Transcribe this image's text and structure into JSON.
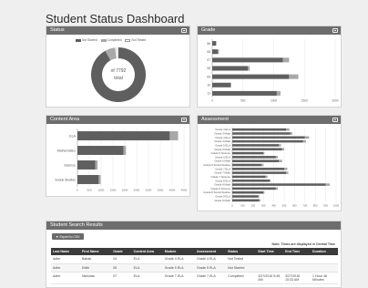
{
  "page": {
    "title": "Student Status Dashboard"
  },
  "panels": {
    "status": "Status",
    "grade": "Grade",
    "content": "Content Area",
    "assessment": "Assessment",
    "results": "Student Search Results"
  },
  "status": {
    "legend": [
      "Not Started",
      "Completed",
      "Not Tested"
    ],
    "center_line1": "of 7792",
    "center_line2": "total"
  },
  "colors": {
    "dark": "#5f5f5f",
    "light": "#a8a8a8",
    "white": "#ffffff"
  },
  "chart_data": [
    {
      "type": "pie",
      "title": "Status",
      "categories": [
        "Not Started",
        "Completed",
        "Not Tested"
      ],
      "values": [
        92,
        6,
        2
      ]
    },
    {
      "type": "bar",
      "title": "Grade",
      "orientation": "horizontal",
      "stacked": true,
      "categories": [
        "5b",
        "06",
        "07",
        "08",
        "09",
        "10",
        "11"
      ],
      "series": [
        {
          "name": "Not Started",
          "values": [
            60,
            90,
            1150,
            580,
            1250,
            300,
            1050
          ]
        },
        {
          "name": "Completed",
          "values": [
            10,
            20,
            100,
            30,
            150,
            10,
            60
          ]
        }
      ],
      "xticks": [
        "0",
        "500",
        "1000",
        "1500",
        "2000"
      ],
      "xlim": [
        0,
        2000
      ]
    },
    {
      "type": "bar",
      "title": "Content Area",
      "orientation": "horizontal",
      "stacked": true,
      "categories": [
        "ELA",
        "Mathematics",
        "Science",
        "Social Studies"
      ],
      "series": [
        {
          "name": "Not Started",
          "values": [
            3900,
            1950,
            750,
            900
          ]
        },
        {
          "name": "Completed",
          "values": [
            350,
            100,
            100,
            80
          ]
        }
      ],
      "xticks": [
        "0",
        "500",
        "1000",
        "1500",
        "2000",
        "2500",
        "3000",
        "3500",
        "4000",
        "4500"
      ],
      "xlim": [
        0,
        4500
      ]
    },
    {
      "type": "bar",
      "title": "Assessment",
      "orientation": "horizontal",
      "stacked": true,
      "categories": [
        "Grade 3 ELA",
        "Grade 3 Math",
        "Grade 4 ELA",
        "Grade 4 Math",
        "Grade 5 ELA",
        "Grade 5 Math",
        "Grade 5 Science",
        "Grade 6 ELA",
        "Grade 6 Math",
        "Grade 6 Social Studies",
        "Grade 7 ELA",
        "Grade 7 Math",
        "Grade 7 Science",
        "Grade 8 ELA",
        "Grade 8 Math",
        "Grade 8 Science",
        "Grade 8 Social Studies",
        "Grade 9 ELA",
        "Grade 9 Math"
      ],
      "series": [
        {
          "name": "Not Started",
          "values": [
            520,
            560,
            700,
            680,
            450,
            480,
            300,
            420,
            450,
            280,
            500,
            520,
            320,
            360,
            900,
            420,
            300,
            250,
            260
          ]
        },
        {
          "name": "Completed",
          "values": [
            30,
            20,
            40,
            30,
            20,
            20,
            10,
            20,
            30,
            20,
            30,
            20,
            20,
            10,
            40,
            20,
            10,
            10,
            10
          ]
        }
      ],
      "xticks": [
        "0",
        "100",
        "200",
        "300",
        "400",
        "500",
        "600",
        "700",
        "800",
        "900",
        "1000"
      ],
      "xlim": [
        0,
        1000
      ]
    }
  ],
  "results": {
    "export_label": "Export to CSV",
    "note": "Note: Times are displayed in Central Time",
    "columns": [
      "Last Name",
      "First Name",
      "Grade",
      "Content Area",
      "Module",
      "Assessment",
      "Status",
      "Start Time",
      "End Time",
      "Duration"
    ],
    "rows": [
      [
        "Adler",
        "Babak",
        "04",
        "ELA",
        "Grade 4 ELA",
        "Grade 4 ELA",
        "Not Tested",
        "",
        "",
        ""
      ],
      [
        "Adler",
        "Edith",
        "05",
        "ELA",
        "Grade 5 ELA",
        "Grade 5 ELA",
        "Not Started",
        "",
        "",
        ""
      ],
      [
        "Adler",
        "Nicholas",
        "07",
        "ELA",
        "Grade 7 ELA",
        "Grade 7 ELA",
        "Completed",
        "3/27/2016 9:45 AM",
        "3/27/2016 10:33 AM",
        "1 Hour 48 Minutes"
      ]
    ]
  }
}
